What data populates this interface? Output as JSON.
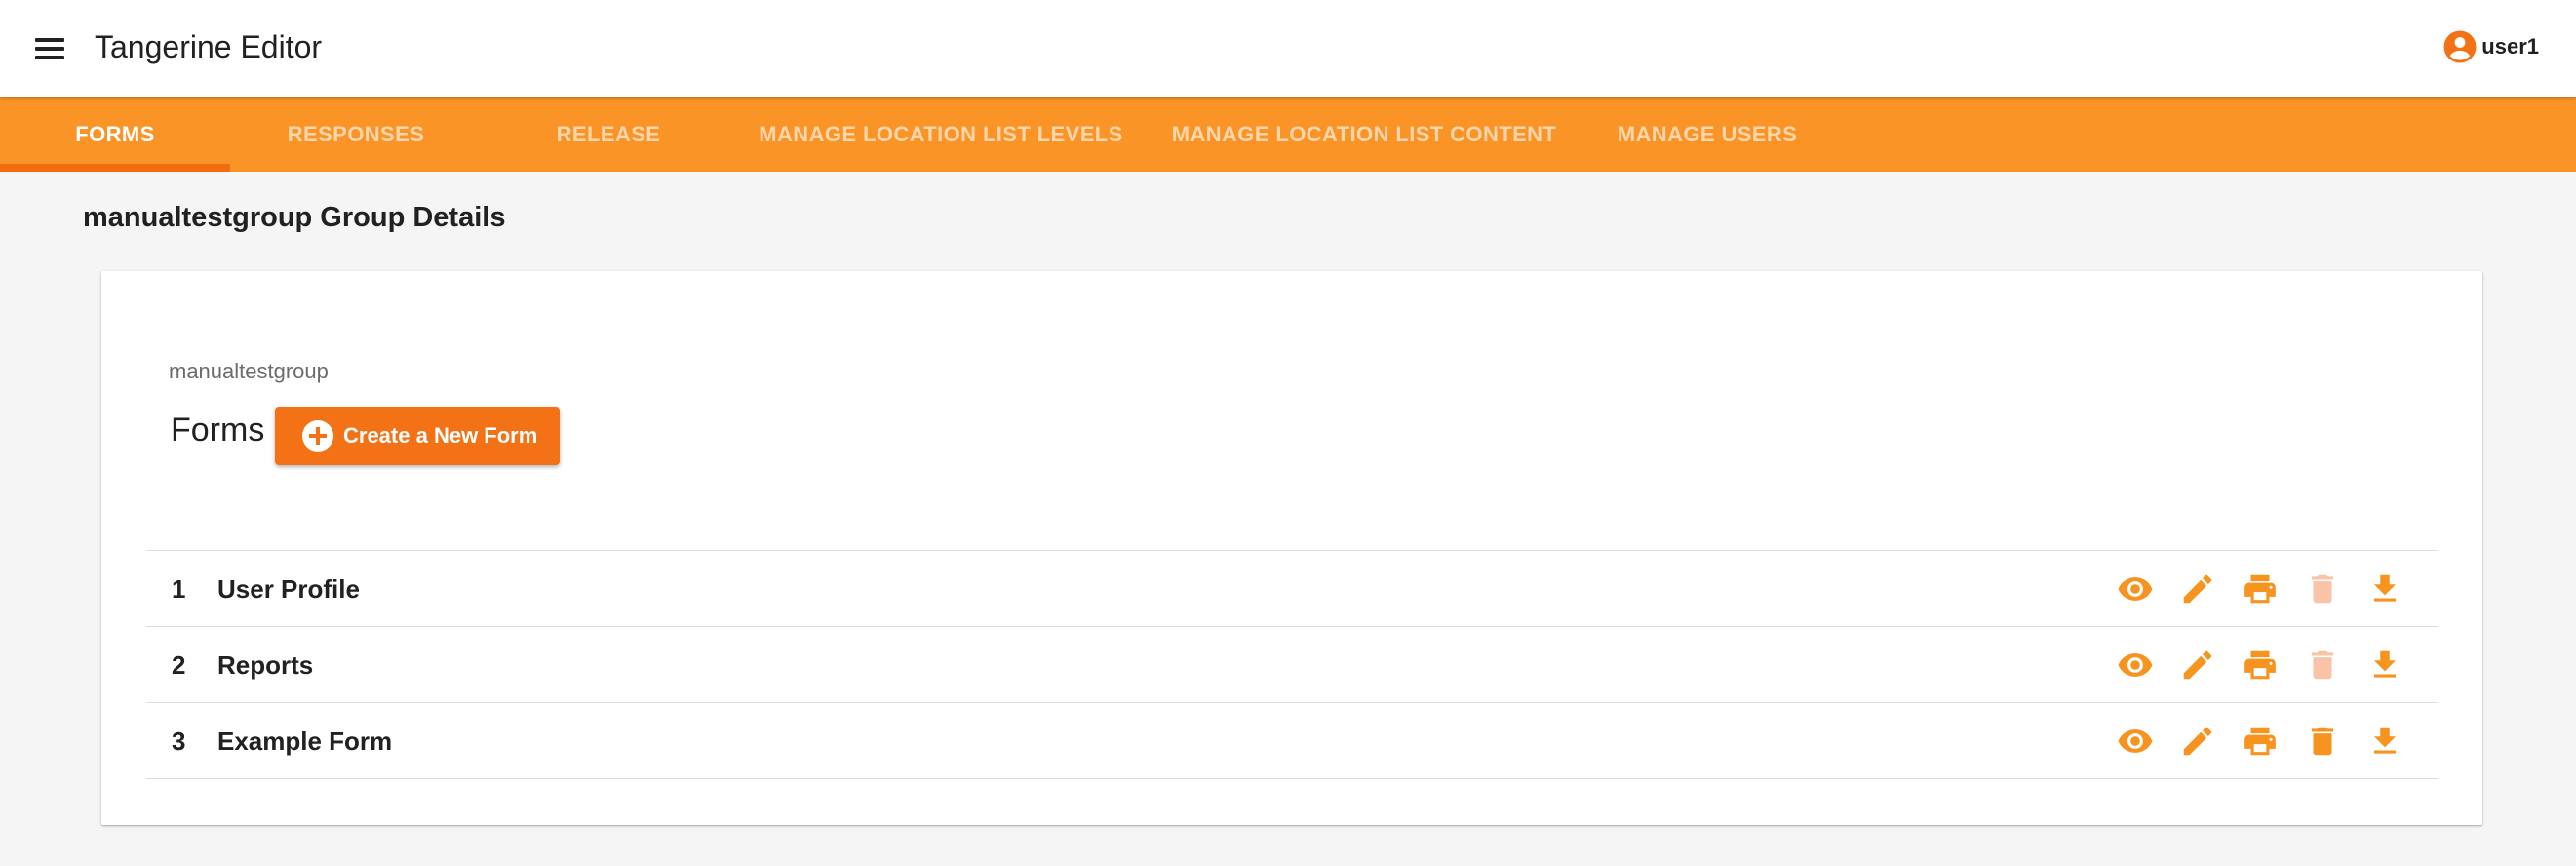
{
  "app": {
    "title": "Tangerine Editor",
    "user": "user1",
    "accent_color": "#fb9426",
    "button_color": "#f47216"
  },
  "tabs": [
    {
      "label": "FORMS",
      "active": true
    },
    {
      "label": "RESPONSES",
      "active": false
    },
    {
      "label": "RELEASE",
      "active": false
    },
    {
      "label": "MANAGE LOCATION LIST LEVELS",
      "active": false
    },
    {
      "label": "MANAGE LOCATION LIST CONTENT",
      "active": false
    },
    {
      "label": "MANAGE USERS",
      "active": false
    }
  ],
  "page": {
    "title": "manualtestgroup Group Details",
    "group_name": "manualtestgroup",
    "forms_heading": "Forms",
    "create_button": "Create a New Form"
  },
  "forms": [
    {
      "number": "1",
      "title": "User Profile",
      "delete_enabled": false
    },
    {
      "number": "2",
      "title": "Reports",
      "delete_enabled": false
    },
    {
      "number": "3",
      "title": "Example Form",
      "delete_enabled": true
    }
  ],
  "row_actions": [
    "view-icon",
    "edit-icon",
    "print-icon",
    "delete-icon",
    "download-icon"
  ]
}
